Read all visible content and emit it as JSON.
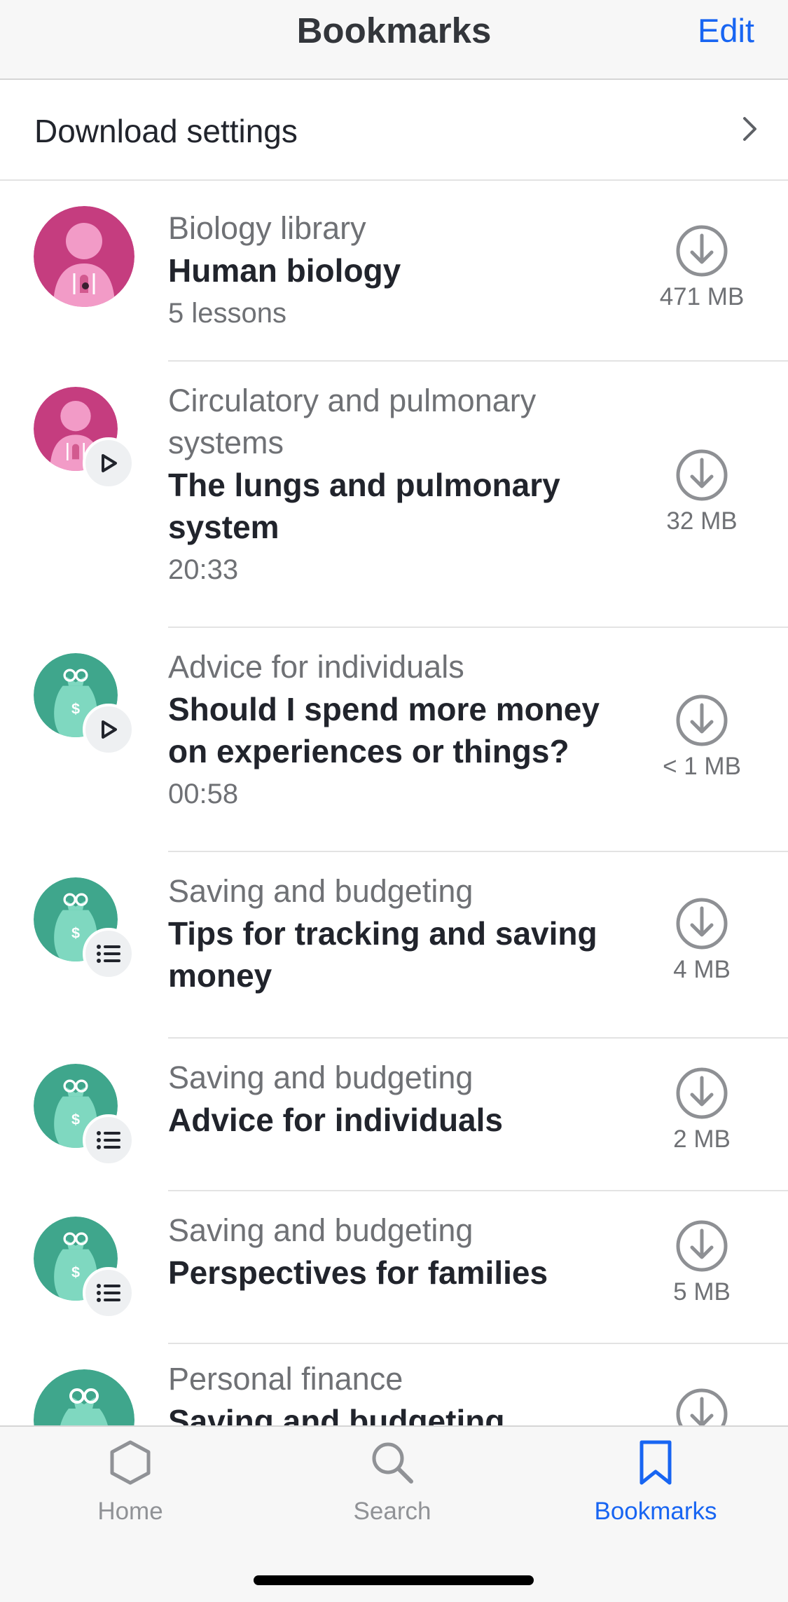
{
  "header": {
    "title": "Bookmarks",
    "edit_label": "Edit"
  },
  "settings": {
    "label": "Download settings",
    "icon": "chevron-right-icon"
  },
  "items": [
    {
      "kicker": "Biology library",
      "title": "Human biology",
      "meta": "5 lessons",
      "size": "471 MB",
      "avatar": "biology",
      "badge": "none"
    },
    {
      "kicker": "Circulatory and pulmonary systems",
      "title": "The lungs and pulmonary system",
      "meta": "20:33",
      "size": "32 MB",
      "avatar": "biology",
      "badge": "play"
    },
    {
      "kicker": "Advice for individuals",
      "title": "Should I spend more money on experiences or things?",
      "meta": "00:58",
      "size": "< 1 MB",
      "avatar": "finance",
      "badge": "play"
    },
    {
      "kicker": "Saving and budgeting",
      "title": "Tips for tracking and saving money",
      "meta": "",
      "size": "4 MB",
      "avatar": "finance",
      "badge": "list"
    },
    {
      "kicker": "Saving and budgeting",
      "title": "Advice for individuals",
      "meta": "",
      "size": "2 MB",
      "avatar": "finance",
      "badge": "list"
    },
    {
      "kicker": "Saving and budgeting",
      "title": "Perspectives for families",
      "meta": "",
      "size": "5 MB",
      "avatar": "finance",
      "badge": "list"
    },
    {
      "kicker": "Personal finance",
      "title": "Saving and budgeting",
      "meta": "",
      "size": "",
      "avatar": "finance",
      "badge": "none"
    }
  ],
  "tabs": [
    {
      "label": "Home",
      "icon": "hexagon-home-icon",
      "active": false
    },
    {
      "label": "Search",
      "icon": "search-icon",
      "active": false
    },
    {
      "label": "Bookmarks",
      "icon": "bookmark-icon",
      "active": true
    }
  ],
  "colors": {
    "accent": "#1865f2",
    "biology": "#c53d7f",
    "finance": "#3fa68c"
  }
}
